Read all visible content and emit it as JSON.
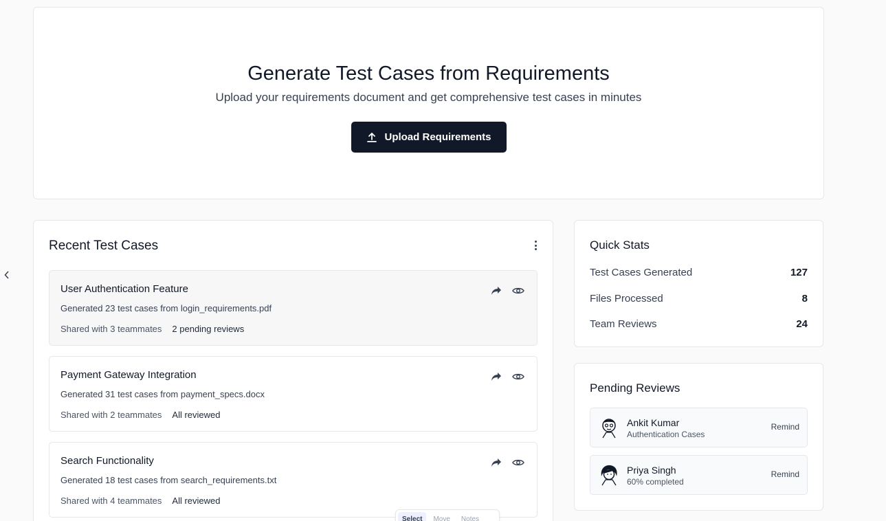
{
  "hero": {
    "title": "Generate Test Cases from Requirements",
    "subtitle": "Upload your requirements document and get comprehensive test cases in minutes",
    "upload_label": "Upload Requirements"
  },
  "recent": {
    "title": "Recent Test Cases",
    "items": [
      {
        "title": "User Authentication Feature",
        "description": "Generated 23 test cases from login_requirements.pdf",
        "shared": "Shared with 3 teammates",
        "status": "2 pending reviews"
      },
      {
        "title": "Payment Gateway Integration",
        "description": "Generated 31 test cases from payment_specs.docx",
        "shared": "Shared with 2 teammates",
        "status": "All reviewed"
      },
      {
        "title": "Search Functionality",
        "description": "Generated 18 test cases from search_requirements.txt",
        "shared": "Shared with 4 teammates",
        "status": "All reviewed"
      }
    ]
  },
  "stats": {
    "title": "Quick Stats",
    "rows": [
      {
        "label": "Test Cases Generated",
        "value": "127"
      },
      {
        "label": "Files Processed",
        "value": "8"
      },
      {
        "label": "Team Reviews",
        "value": "24"
      }
    ]
  },
  "reviews": {
    "title": "Pending Reviews",
    "items": [
      {
        "name": "Ankit Kumar",
        "subtitle": "Authentication Cases",
        "action": "Remind"
      },
      {
        "name": "Priya Singh",
        "subtitle": "60% completed",
        "action": "Remind"
      }
    ]
  },
  "toolbar": {
    "items": [
      "Select",
      "Move",
      "Notes"
    ]
  },
  "colors": {
    "primary_button": "#111827",
    "background": "#fafafa",
    "card_border": "#e5e7eb"
  }
}
